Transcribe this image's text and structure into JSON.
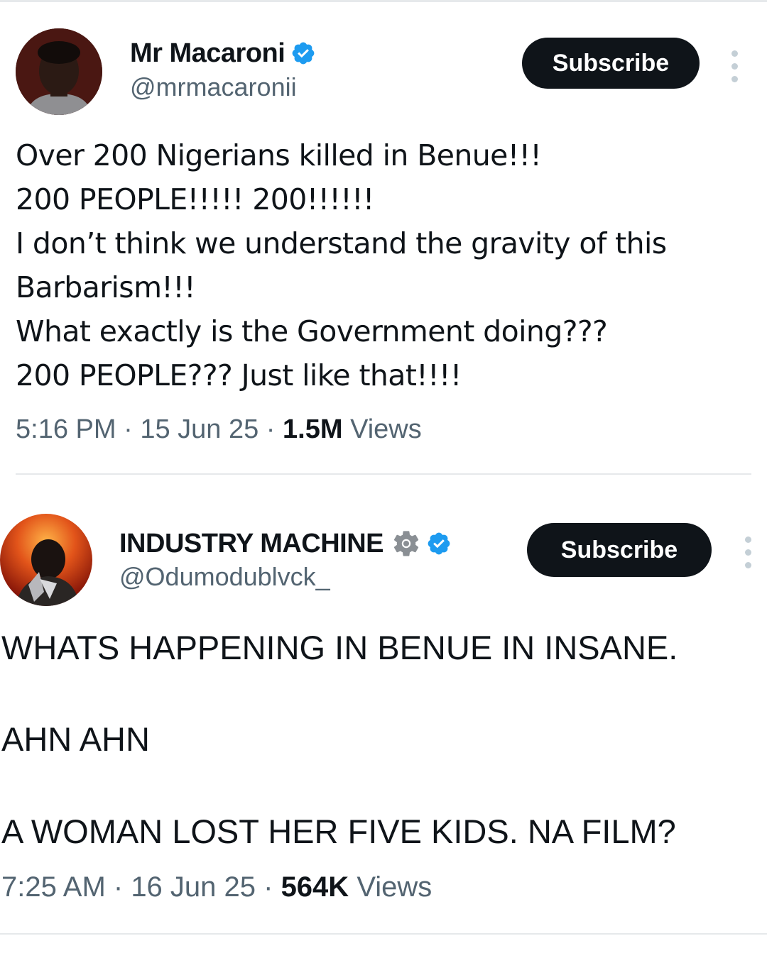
{
  "tweets": [
    {
      "display_name": "Mr Macaroni",
      "handle": "@mrmacaronii",
      "verified_icon": "verified-badge-icon",
      "subscribe_label": "Subscribe",
      "more_icon": "more-vertical-icon",
      "text_lines": [
        "Over 200 Nigerians killed in Benue!!!",
        "200 PEOPLE!!!!! 200!!!!!!",
        "I don’t think we understand the gravity of this",
        "Barbarism!!!",
        "What exactly is the Government doing???",
        "200 PEOPLE??? Just like that!!!!"
      ],
      "time": "5:16 PM",
      "date": "15 Jun 25",
      "views_count": "1.5M",
      "views_label": "Views"
    },
    {
      "display_name": "INDUSTRY MACHINE",
      "handle": "@Odumodublvck_",
      "gear_icon": "gear-icon",
      "verified_icon": "verified-badge-icon",
      "subscribe_label": "Subscribe",
      "more_icon": "more-vertical-icon",
      "text_lines": [
        "WHATS HAPPENING IN BENUE IN INSANE.",
        "AHN AHN",
        "A WOMAN LOST HER FIVE KIDS. NA FILM?"
      ],
      "time": "7:25 AM",
      "date": "16 Jun 25",
      "views_count": "564K",
      "views_label": "Views"
    }
  ],
  "separator": " · ",
  "colors": {
    "verified_blue": "#1d9bf0",
    "button_bg": "#0f1419",
    "secondary_text": "#536471"
  }
}
